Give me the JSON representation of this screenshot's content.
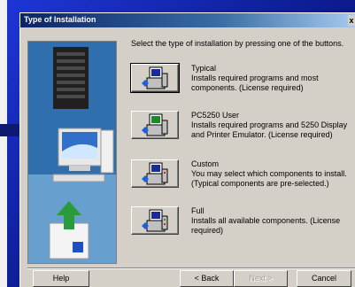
{
  "window": {
    "title": "Type of Installation",
    "close_label": "x"
  },
  "instructions": "Select the type of installation by pressing one of the buttons.",
  "options": [
    {
      "title": "Typical",
      "description": "Installs required programs and most components.  (License required)"
    },
    {
      "title": "PC5250 User",
      "description": "Installs required programs and 5250 Display and Printer Emulator.  (License required)"
    },
    {
      "title": "Custom",
      "description": "You may select which components to install. (Typical components are pre-selected.)"
    },
    {
      "title": "Full",
      "description": "Installs all available components.  (License required)"
    }
  ],
  "buttons": {
    "help": "Help",
    "back": "< Back",
    "next": "Next >",
    "cancel": "Cancel"
  },
  "icons": {
    "option_icon": "computer-setup-icon",
    "side_image": "computers-setup-illustration"
  },
  "colors": {
    "titlebar_start": "#0a246a",
    "titlebar_end": "#a6caf0",
    "dialog_face": "#d4d0c8",
    "desktop": "#0b1a8c"
  }
}
